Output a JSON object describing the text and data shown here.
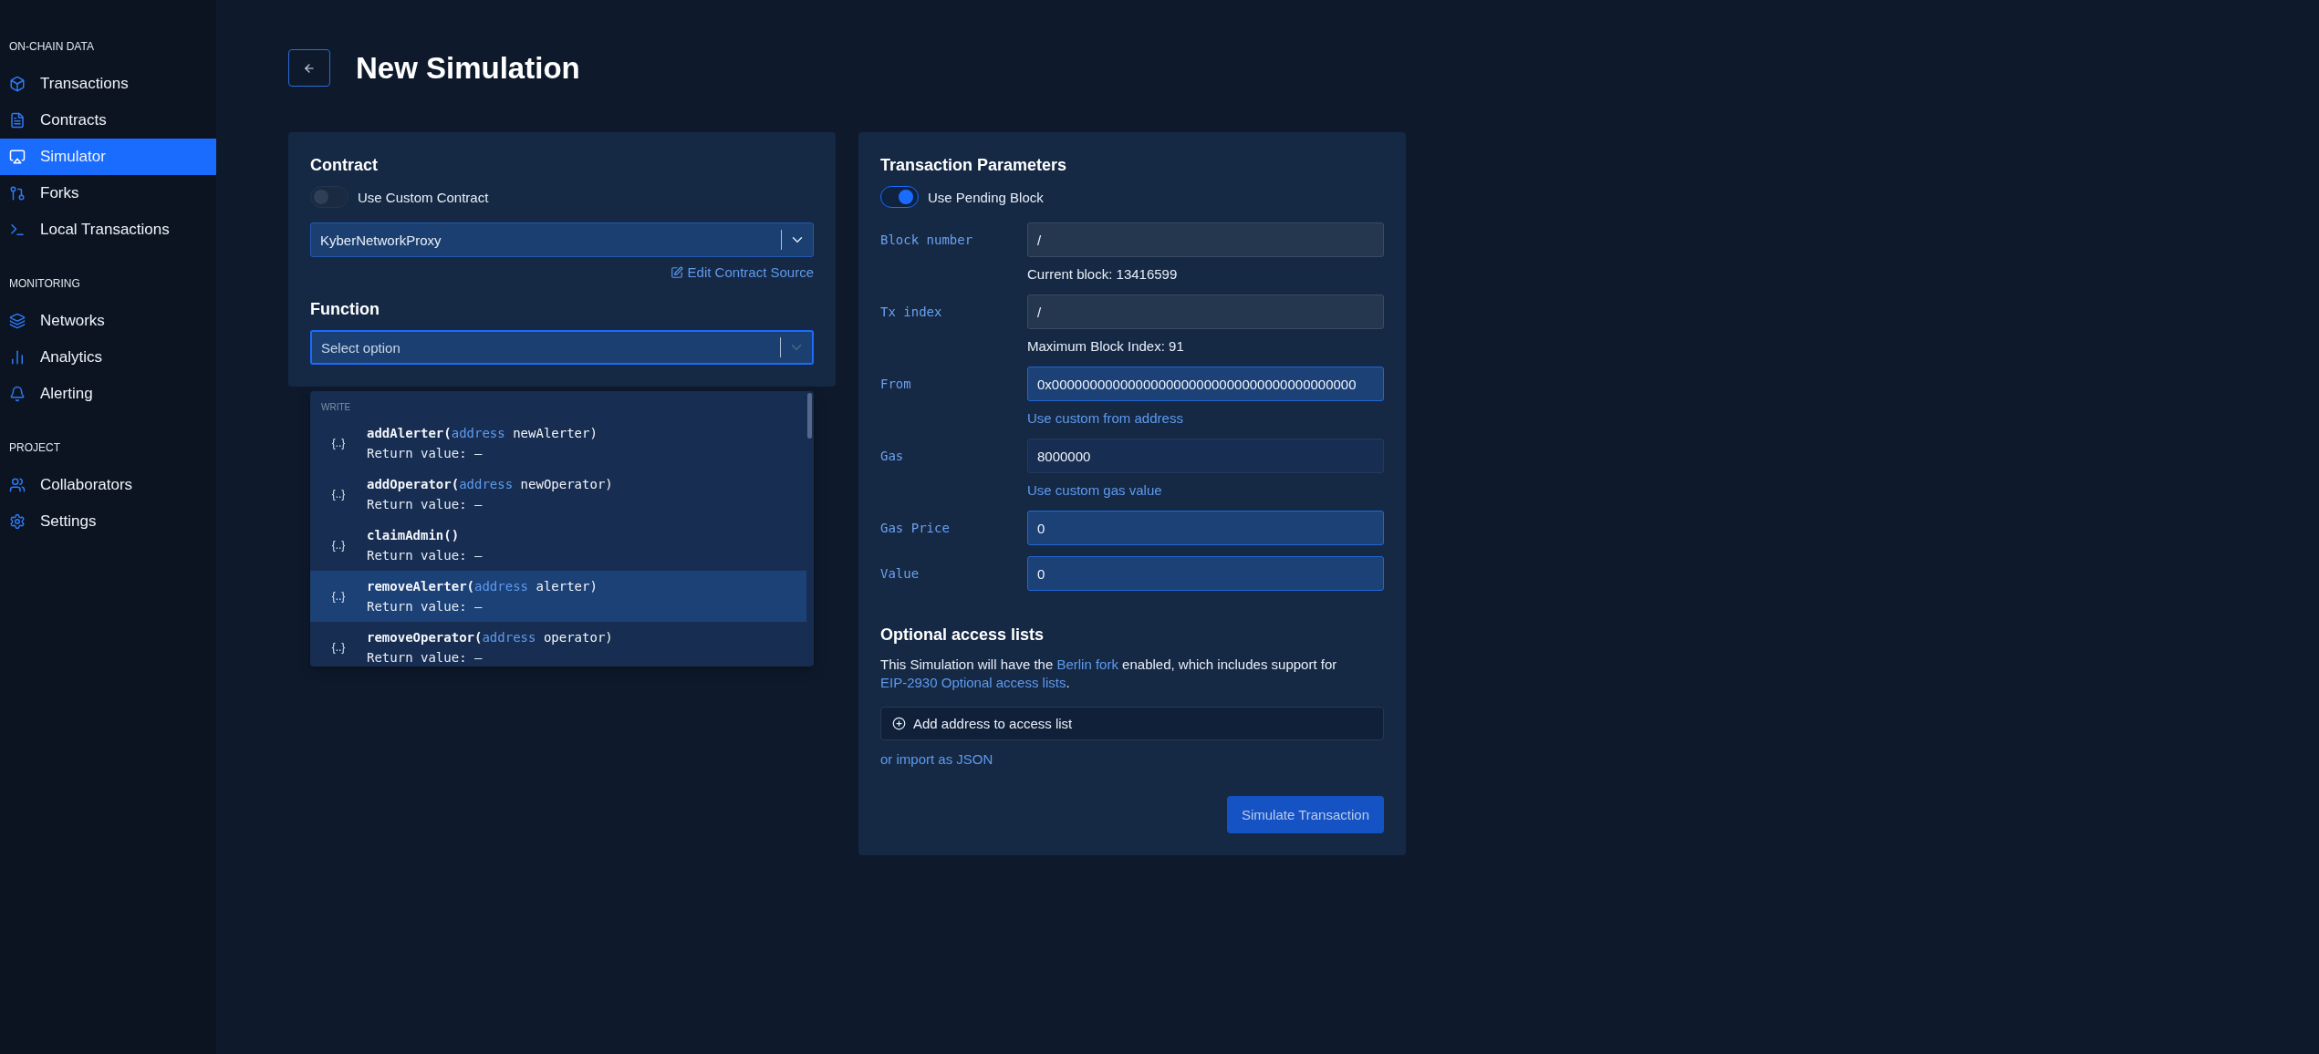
{
  "sidebar": {
    "sections": [
      {
        "title": "ON-CHAIN DATA",
        "items": [
          {
            "label": "Transactions",
            "selected": false
          },
          {
            "label": "Contracts",
            "selected": false
          },
          {
            "label": "Simulator",
            "selected": true
          },
          {
            "label": "Forks",
            "selected": false
          },
          {
            "label": "Local Transactions",
            "selected": false
          }
        ]
      },
      {
        "title": "MONITORING",
        "items": [
          {
            "label": "Networks",
            "selected": false
          },
          {
            "label": "Analytics",
            "selected": false
          },
          {
            "label": "Alerting",
            "selected": false
          }
        ]
      },
      {
        "title": "PROJECT",
        "items": [
          {
            "label": "Collaborators",
            "selected": false
          },
          {
            "label": "Settings",
            "selected": false
          }
        ]
      }
    ]
  },
  "page_title": "New Simulation",
  "contract_panel": {
    "heading": "Contract",
    "toggle": {
      "label": "Use Custom Contract",
      "on": false
    },
    "contract_select": {
      "value": "KyberNetworkProxy"
    },
    "edit_link": "Edit Contract Source",
    "function_heading": "Function",
    "function_select": {
      "placeholder": "Select option",
      "open": true
    },
    "menu": {
      "group": "WRITE",
      "options": [
        {
          "icon_text": "{..}",
          "signature": [
            {
              "kind": "name",
              "text": "addAlerter("
            },
            {
              "kind": "type",
              "text": "address"
            },
            {
              "kind": "plain",
              "text": " newAlerter)"
            }
          ],
          "returns": "Return value: –",
          "highlighted": false
        },
        {
          "icon_text": "{..}",
          "signature": [
            {
              "kind": "name",
              "text": "addOperator("
            },
            {
              "kind": "type",
              "text": "address"
            },
            {
              "kind": "plain",
              "text": " newOperator)"
            }
          ],
          "returns": "Return value: –",
          "highlighted": false
        },
        {
          "icon_text": "{..}",
          "signature": [
            {
              "kind": "name",
              "text": "claimAdmin()"
            }
          ],
          "returns": "Return value: –",
          "highlighted": false
        },
        {
          "icon_text": "{..}",
          "signature": [
            {
              "kind": "name",
              "text": "removeAlerter("
            },
            {
              "kind": "type",
              "text": "address"
            },
            {
              "kind": "plain",
              "text": " alerter)"
            }
          ],
          "returns": "Return value: –",
          "highlighted": true
        },
        {
          "icon_text": "{..}",
          "signature": [
            {
              "kind": "name",
              "text": "removeOperator("
            },
            {
              "kind": "type",
              "text": "address"
            },
            {
              "kind": "plain",
              "text": " operator)"
            }
          ],
          "returns": "Return value: –",
          "highlighted": false
        }
      ]
    }
  },
  "params_panel": {
    "heading": "Transaction Parameters",
    "toggle": {
      "label": "Use Pending Block",
      "on": true
    },
    "fields": [
      {
        "label": "Block number",
        "value": "/",
        "disabled": true,
        "highlighted": false,
        "note": {
          "text": "Current block: 13416599",
          "link": false
        }
      },
      {
        "label": "Tx index",
        "value": "/",
        "disabled": true,
        "highlighted": false,
        "note": {
          "text": "Maximum Block Index: 91",
          "link": false
        }
      },
      {
        "label": "From",
        "value": "0x0000000000000000000000000000000000000000",
        "disabled": false,
        "highlighted": true,
        "note": {
          "text": "Use custom from address",
          "link": true
        }
      },
      {
        "label": "Gas",
        "value": "8000000",
        "disabled": false,
        "highlighted": false,
        "note": {
          "text": "Use custom gas value",
          "link": true
        }
      },
      {
        "label": "Gas Price",
        "value": "0",
        "disabled": false,
        "highlighted": true
      },
      {
        "label": "Value",
        "value": "0",
        "disabled": false,
        "highlighted": true
      }
    ],
    "access": {
      "heading": "Optional access lists",
      "description": [
        {
          "text": "This Simulation will have the ",
          "link": false
        },
        {
          "text": "Berlin fork",
          "link": true
        },
        {
          "text": " enabled, which includes support for ",
          "link": false
        },
        {
          "text": "EIP-2930 Optional access lists",
          "link": true
        },
        {
          "text": ".",
          "link": false
        }
      ],
      "add_button": "Add address to access list",
      "import_link": "or import as JSON"
    },
    "submit": "Simulate Transaction"
  }
}
